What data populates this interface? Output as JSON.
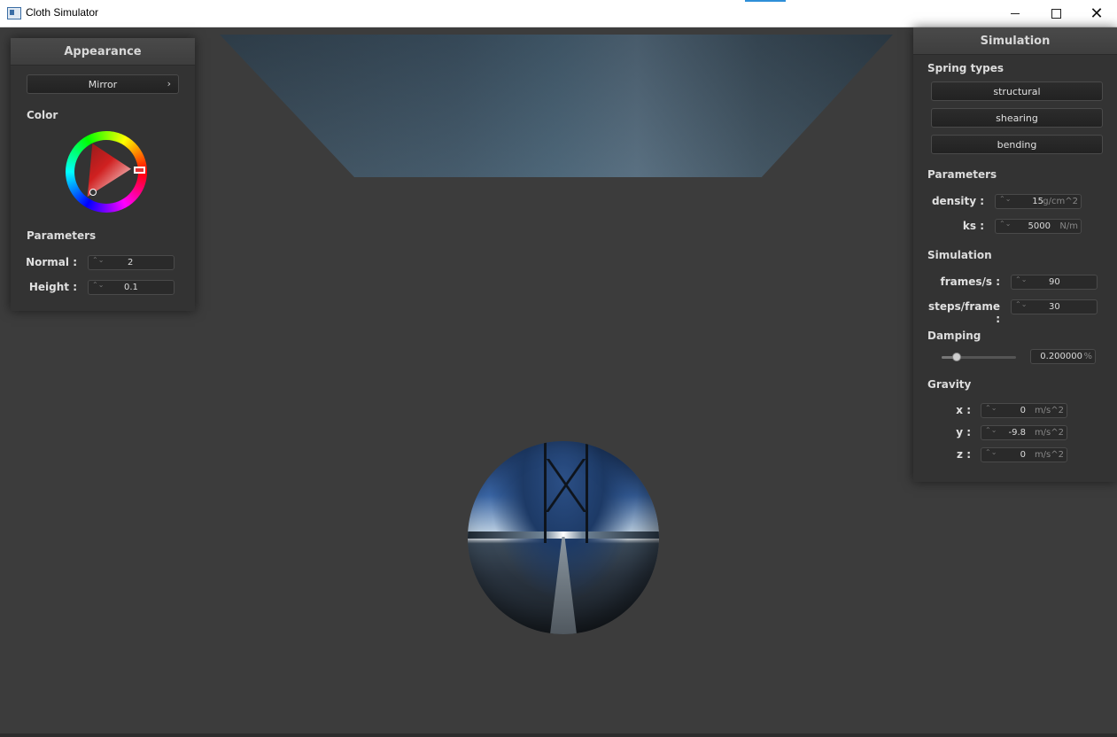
{
  "window": {
    "title": "Cloth Simulator",
    "minimize_icon": "minimize-icon",
    "maximize_icon": "maximize-icon",
    "close_icon": "close-icon",
    "close_glyph": "✕"
  },
  "appearance": {
    "header": "Appearance",
    "shader_dropdown": {
      "selected": "Mirror",
      "chevron": "›"
    },
    "color_label": "Color",
    "color_wheel": {
      "selected_hue": "#e03030"
    },
    "parameters_label": "Parameters",
    "params": [
      {
        "label": "Normal :",
        "value": "2"
      },
      {
        "label": "Height :",
        "value": "0.1"
      }
    ]
  },
  "simulation": {
    "header": "Simulation",
    "spring_types_label": "Spring types",
    "spring_buttons": [
      "structural",
      "shearing",
      "bending"
    ],
    "parameters_label": "Parameters",
    "params": [
      {
        "label": "density :",
        "value": "15",
        "unit": "g/cm^2"
      },
      {
        "label": "ks :",
        "value": "5000",
        "unit": "N/m"
      }
    ],
    "simulation_label": "Simulation",
    "sim_params": [
      {
        "label": "frames/s :",
        "value": "90"
      },
      {
        "label": "steps/frame :",
        "value": "30"
      }
    ],
    "damping_label": "Damping",
    "damping": {
      "value": "0.200000",
      "unit": "%",
      "slider_fraction": 0.2
    },
    "gravity_label": "Gravity",
    "gravity": [
      {
        "label": "x :",
        "value": "0",
        "unit": "m/s^2"
      },
      {
        "label": "y :",
        "value": "-9.8",
        "unit": "m/s^2"
      },
      {
        "label": "z :",
        "value": "0",
        "unit": "m/s^2"
      }
    ]
  },
  "spinner_glyph": "⌃⌄"
}
